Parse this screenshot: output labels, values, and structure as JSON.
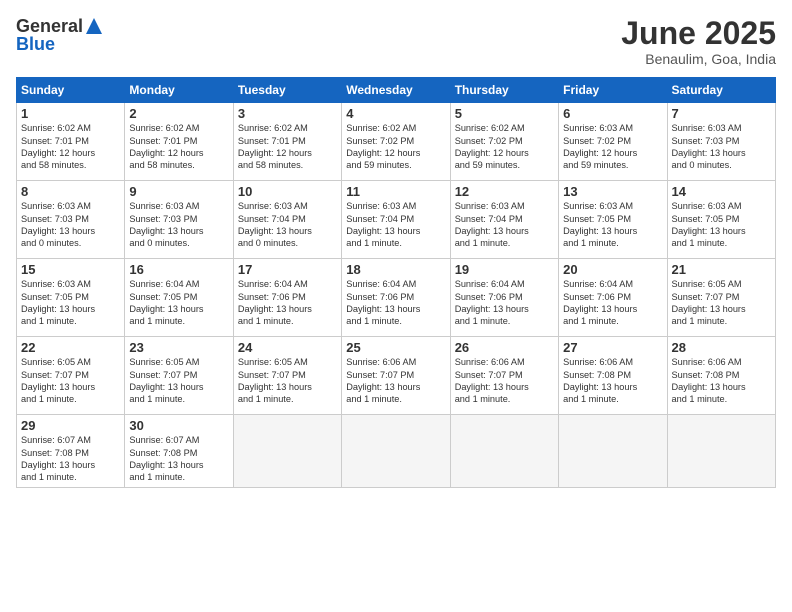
{
  "logo": {
    "general": "General",
    "blue": "Blue"
  },
  "title": "June 2025",
  "subtitle": "Benaulim, Goa, India",
  "headers": [
    "Sunday",
    "Monday",
    "Tuesday",
    "Wednesday",
    "Thursday",
    "Friday",
    "Saturday"
  ],
  "weeks": [
    [
      {
        "day": "1",
        "text": "Sunrise: 6:02 AM\nSunset: 7:01 PM\nDaylight: 12 hours\nand 58 minutes."
      },
      {
        "day": "2",
        "text": "Sunrise: 6:02 AM\nSunset: 7:01 PM\nDaylight: 12 hours\nand 58 minutes."
      },
      {
        "day": "3",
        "text": "Sunrise: 6:02 AM\nSunset: 7:01 PM\nDaylight: 12 hours\nand 58 minutes."
      },
      {
        "day": "4",
        "text": "Sunrise: 6:02 AM\nSunset: 7:02 PM\nDaylight: 12 hours\nand 59 minutes."
      },
      {
        "day": "5",
        "text": "Sunrise: 6:02 AM\nSunset: 7:02 PM\nDaylight: 12 hours\nand 59 minutes."
      },
      {
        "day": "6",
        "text": "Sunrise: 6:03 AM\nSunset: 7:02 PM\nDaylight: 12 hours\nand 59 minutes."
      },
      {
        "day": "7",
        "text": "Sunrise: 6:03 AM\nSunset: 7:03 PM\nDaylight: 13 hours\nand 0 minutes."
      }
    ],
    [
      {
        "day": "8",
        "text": "Sunrise: 6:03 AM\nSunset: 7:03 PM\nDaylight: 13 hours\nand 0 minutes."
      },
      {
        "day": "9",
        "text": "Sunrise: 6:03 AM\nSunset: 7:03 PM\nDaylight: 13 hours\nand 0 minutes."
      },
      {
        "day": "10",
        "text": "Sunrise: 6:03 AM\nSunset: 7:04 PM\nDaylight: 13 hours\nand 0 minutes."
      },
      {
        "day": "11",
        "text": "Sunrise: 6:03 AM\nSunset: 7:04 PM\nDaylight: 13 hours\nand 1 minute."
      },
      {
        "day": "12",
        "text": "Sunrise: 6:03 AM\nSunset: 7:04 PM\nDaylight: 13 hours\nand 1 minute."
      },
      {
        "day": "13",
        "text": "Sunrise: 6:03 AM\nSunset: 7:05 PM\nDaylight: 13 hours\nand 1 minute."
      },
      {
        "day": "14",
        "text": "Sunrise: 6:03 AM\nSunset: 7:05 PM\nDaylight: 13 hours\nand 1 minute."
      }
    ],
    [
      {
        "day": "15",
        "text": "Sunrise: 6:03 AM\nSunset: 7:05 PM\nDaylight: 13 hours\nand 1 minute."
      },
      {
        "day": "16",
        "text": "Sunrise: 6:04 AM\nSunset: 7:05 PM\nDaylight: 13 hours\nand 1 minute."
      },
      {
        "day": "17",
        "text": "Sunrise: 6:04 AM\nSunset: 7:06 PM\nDaylight: 13 hours\nand 1 minute."
      },
      {
        "day": "18",
        "text": "Sunrise: 6:04 AM\nSunset: 7:06 PM\nDaylight: 13 hours\nand 1 minute."
      },
      {
        "day": "19",
        "text": "Sunrise: 6:04 AM\nSunset: 7:06 PM\nDaylight: 13 hours\nand 1 minute."
      },
      {
        "day": "20",
        "text": "Sunrise: 6:04 AM\nSunset: 7:06 PM\nDaylight: 13 hours\nand 1 minute."
      },
      {
        "day": "21",
        "text": "Sunrise: 6:05 AM\nSunset: 7:07 PM\nDaylight: 13 hours\nand 1 minute."
      }
    ],
    [
      {
        "day": "22",
        "text": "Sunrise: 6:05 AM\nSunset: 7:07 PM\nDaylight: 13 hours\nand 1 minute."
      },
      {
        "day": "23",
        "text": "Sunrise: 6:05 AM\nSunset: 7:07 PM\nDaylight: 13 hours\nand 1 minute."
      },
      {
        "day": "24",
        "text": "Sunrise: 6:05 AM\nSunset: 7:07 PM\nDaylight: 13 hours\nand 1 minute."
      },
      {
        "day": "25",
        "text": "Sunrise: 6:06 AM\nSunset: 7:07 PM\nDaylight: 13 hours\nand 1 minute."
      },
      {
        "day": "26",
        "text": "Sunrise: 6:06 AM\nSunset: 7:07 PM\nDaylight: 13 hours\nand 1 minute."
      },
      {
        "day": "27",
        "text": "Sunrise: 6:06 AM\nSunset: 7:08 PM\nDaylight: 13 hours\nand 1 minute."
      },
      {
        "day": "28",
        "text": "Sunrise: 6:06 AM\nSunset: 7:08 PM\nDaylight: 13 hours\nand 1 minute."
      }
    ],
    [
      {
        "day": "29",
        "text": "Sunrise: 6:07 AM\nSunset: 7:08 PM\nDaylight: 13 hours\nand 1 minute."
      },
      {
        "day": "30",
        "text": "Sunrise: 6:07 AM\nSunset: 7:08 PM\nDaylight: 13 hours\nand 1 minute."
      },
      {
        "day": "",
        "text": ""
      },
      {
        "day": "",
        "text": ""
      },
      {
        "day": "",
        "text": ""
      },
      {
        "day": "",
        "text": ""
      },
      {
        "day": "",
        "text": ""
      }
    ]
  ]
}
